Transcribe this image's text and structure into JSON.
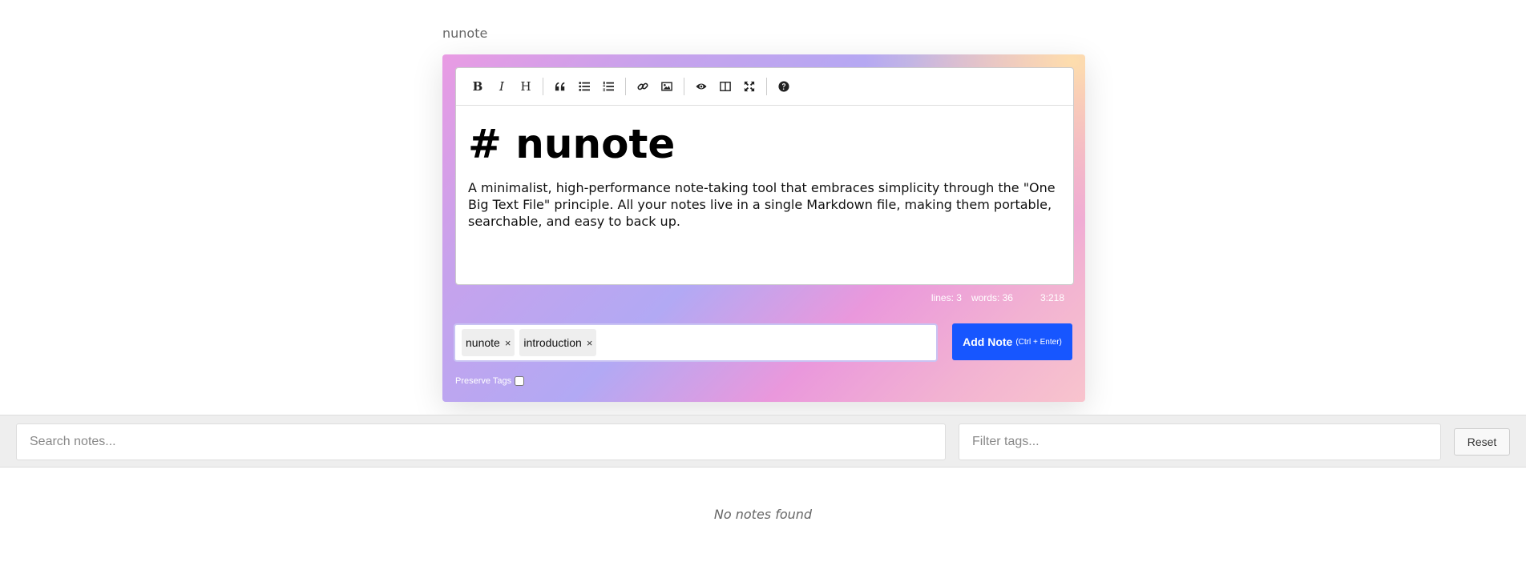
{
  "app": {
    "title": "nunote"
  },
  "editor": {
    "heading": "# nunote",
    "paragraph": "A minimalist, high-performance note-taking tool that embraces simplicity through the \"One Big Text File\" principle. All your notes live in a single Markdown file, making them portable, searchable, and easy to back up.",
    "toolbar": [
      {
        "icon": "bold-icon",
        "glyph": "B"
      },
      {
        "icon": "italic-icon",
        "glyph": "I"
      },
      {
        "icon": "heading-icon",
        "glyph": "H"
      },
      {
        "icon": "quote-icon"
      },
      {
        "icon": "unordered-list-icon"
      },
      {
        "icon": "ordered-list-icon"
      },
      {
        "icon": "link-icon"
      },
      {
        "icon": "image-icon"
      },
      {
        "icon": "preview-icon"
      },
      {
        "icon": "side-by-side-icon"
      },
      {
        "icon": "fullscreen-icon"
      },
      {
        "icon": "help-icon"
      }
    ],
    "status": {
      "lines": "lines: 3",
      "words": "words: 36",
      "cursor": "3:218"
    }
  },
  "tags": [
    {
      "label": "nunote",
      "remove": "×"
    },
    {
      "label": "introduction",
      "remove": "×"
    }
  ],
  "add_button": {
    "label": "Add Note",
    "hint": "(Ctrl + Enter)"
  },
  "preserve_tags": {
    "label": "Preserve Tags",
    "checked": false
  },
  "filters": {
    "search_placeholder": "Search notes...",
    "tags_placeholder": "Filter tags...",
    "reset_label": "Reset"
  },
  "empty_message": "No notes found",
  "colors": {
    "accent": "#1756ff"
  }
}
